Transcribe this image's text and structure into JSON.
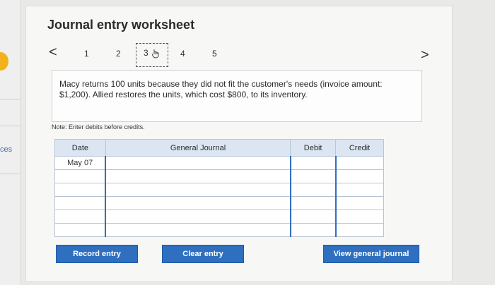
{
  "sidebar": {
    "cut_text": "ces"
  },
  "header": {
    "title": "Journal entry worksheet"
  },
  "nav": {
    "prev_label": "<",
    "next_label": ">",
    "steps": [
      "1",
      "2",
      "3",
      "4",
      "5"
    ],
    "current_step": 3
  },
  "problem": {
    "text": "Macy returns 100 units because they did not fit the customer's needs (invoice amount: $1,200). Allied restores the units, which cost $800, to its inventory."
  },
  "note": "Note: Enter debits before credits.",
  "journal": {
    "headers": {
      "date": "Date",
      "account": "General Journal",
      "debit": "Debit",
      "credit": "Credit"
    },
    "rows": [
      {
        "date": "May 07",
        "account": "",
        "debit": "",
        "credit": ""
      },
      {
        "date": "",
        "account": "",
        "debit": "",
        "credit": ""
      },
      {
        "date": "",
        "account": "",
        "debit": "",
        "credit": ""
      },
      {
        "date": "",
        "account": "",
        "debit": "",
        "credit": ""
      },
      {
        "date": "",
        "account": "",
        "debit": "",
        "credit": ""
      },
      {
        "date": "",
        "account": "",
        "debit": "",
        "credit": ""
      }
    ]
  },
  "buttons": {
    "record": "Record entry",
    "clear": "Clear entry",
    "view": "View general journal"
  },
  "colors": {
    "button_blue": "#2f6fbf",
    "header_blue": "#dce6f2",
    "accent_orange": "#f2b21b"
  }
}
